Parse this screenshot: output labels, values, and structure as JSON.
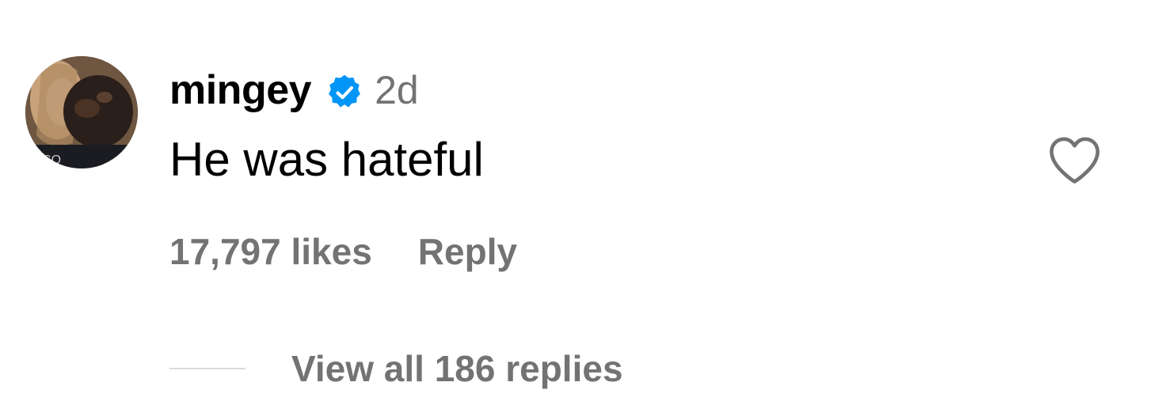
{
  "comment": {
    "username": "mingey",
    "verified": true,
    "timestamp": "2d",
    "text": "He was hateful",
    "likes_label": "17,797 likes",
    "reply_label": "Reply",
    "view_replies_label": "View all 186 replies",
    "liked": false
  },
  "icons": {
    "verified": "verified-badge-icon",
    "like": "heart-outline-icon",
    "avatar": "user-avatar"
  },
  "colors": {
    "text_primary": "#000000",
    "text_secondary": "#737373",
    "verified_blue": "#0095f6",
    "divider": "#dbdbdb"
  }
}
